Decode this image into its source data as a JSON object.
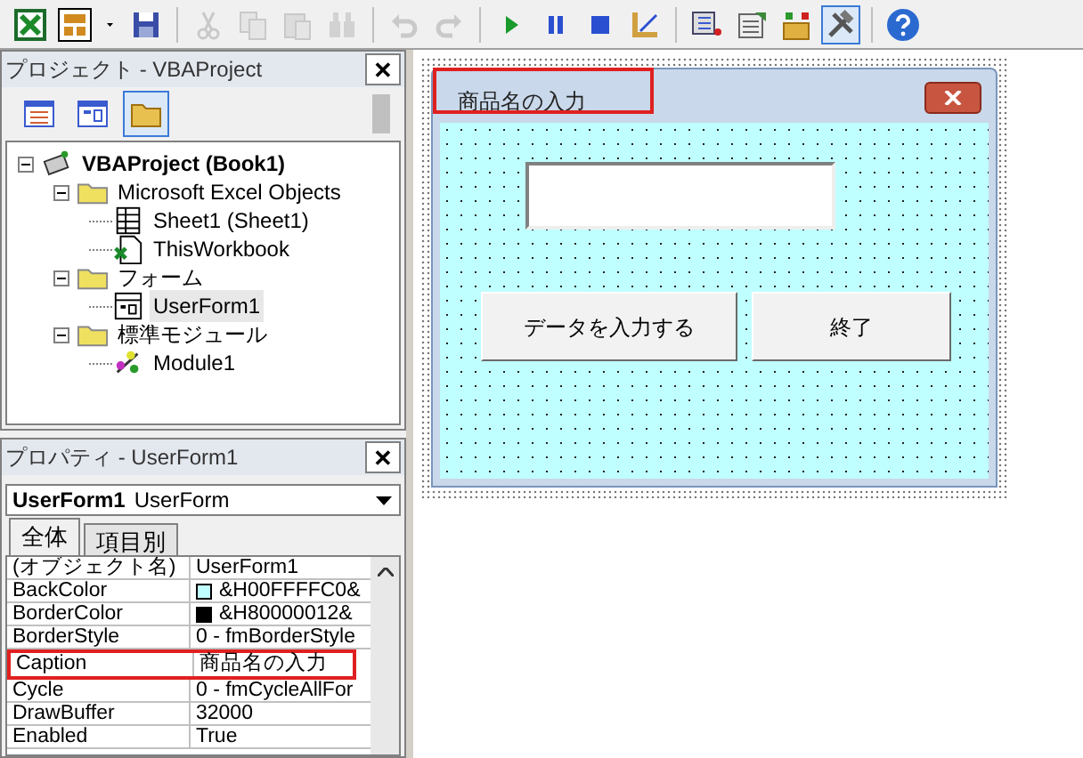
{
  "toolbar": [
    {
      "kind": "excel",
      "disabled": false,
      "selected": false
    },
    {
      "kind": "insert",
      "disabled": false,
      "selected": false
    },
    {
      "kind": "caret",
      "disabled": false,
      "selected": false
    },
    {
      "kind": "save",
      "disabled": false,
      "selected": false
    },
    {
      "kind": "sep"
    },
    {
      "kind": "cut",
      "disabled": true,
      "selected": false
    },
    {
      "kind": "copy",
      "disabled": true,
      "selected": false
    },
    {
      "kind": "paste",
      "disabled": true,
      "selected": false
    },
    {
      "kind": "find",
      "disabled": true,
      "selected": false
    },
    {
      "kind": "sep"
    },
    {
      "kind": "undo",
      "disabled": true,
      "selected": false
    },
    {
      "kind": "redo",
      "disabled": true,
      "selected": false
    },
    {
      "kind": "sep"
    },
    {
      "kind": "run",
      "disabled": false,
      "selected": false
    },
    {
      "kind": "pause",
      "disabled": false,
      "selected": false
    },
    {
      "kind": "stop",
      "disabled": false,
      "selected": false
    },
    {
      "kind": "design",
      "disabled": false,
      "selected": false
    },
    {
      "kind": "sep"
    },
    {
      "kind": "explorer",
      "disabled": false,
      "selected": false
    },
    {
      "kind": "props",
      "disabled": false,
      "selected": false
    },
    {
      "kind": "browser",
      "disabled": false,
      "selected": false
    },
    {
      "kind": "toolbox",
      "disabled": false,
      "selected": true
    },
    {
      "kind": "sep"
    },
    {
      "kind": "help",
      "disabled": false,
      "selected": false
    }
  ],
  "project": {
    "title": "プロジェクト - VBAProject",
    "close": "✕",
    "buttons": [
      {
        "kind": "code",
        "selected": false
      },
      {
        "kind": "object",
        "selected": false
      },
      {
        "kind": "folders",
        "selected": true
      }
    ],
    "tree": [
      {
        "label": "VBAProject (Book1)",
        "kind": "project",
        "bold": true,
        "expanded": true,
        "selected": false,
        "children": [
          {
            "label": "Microsoft Excel Objects",
            "kind": "folder",
            "expanded": true,
            "selected": false,
            "children": [
              {
                "label": "Sheet1 (Sheet1)",
                "kind": "sheet",
                "selected": false
              },
              {
                "label": "ThisWorkbook",
                "kind": "workbook",
                "selected": false
              }
            ]
          },
          {
            "label": "フォーム",
            "kind": "folder",
            "expanded": true,
            "selected": false,
            "children": [
              {
                "label": "UserForm1",
                "kind": "form",
                "selected": true
              }
            ]
          },
          {
            "label": "標準モジュール",
            "kind": "folder",
            "expanded": true,
            "selected": false,
            "children": [
              {
                "label": "Module1",
                "kind": "module",
                "selected": false
              }
            ]
          }
        ]
      }
    ]
  },
  "properties": {
    "title": "プロパティ - UserForm1",
    "close": "✕",
    "object": {
      "name": "UserForm1",
      "type": "UserForm"
    },
    "tabs": [
      {
        "label": "全体",
        "selected": true
      },
      {
        "label": "項目別",
        "selected": false
      }
    ],
    "rows": [
      {
        "name": "(オブジェクト名)",
        "value": "UserForm1",
        "highlighted": false
      },
      {
        "name": "BackColor",
        "value": "&H00FFFFC0&",
        "color": "#c0ffff",
        "highlighted": false
      },
      {
        "name": "BorderColor",
        "value": "&H80000012&",
        "color": "#000000",
        "highlighted": false
      },
      {
        "name": "BorderStyle",
        "value": "0 - fmBorderStyle",
        "highlighted": false
      },
      {
        "name": "Caption",
        "value": "商品名の入力",
        "highlighted": true
      },
      {
        "name": "Cycle",
        "value": "0 - fmCycleAllFor",
        "highlighted": false
      },
      {
        "name": "DrawBuffer",
        "value": "32000",
        "highlighted": false
      },
      {
        "name": "Enabled",
        "value": "True",
        "highlighted": false
      }
    ]
  },
  "form": {
    "caption": "商品名の入力",
    "caption_highlighted": true,
    "buttons": [
      "データを入力する",
      "終了"
    ]
  }
}
